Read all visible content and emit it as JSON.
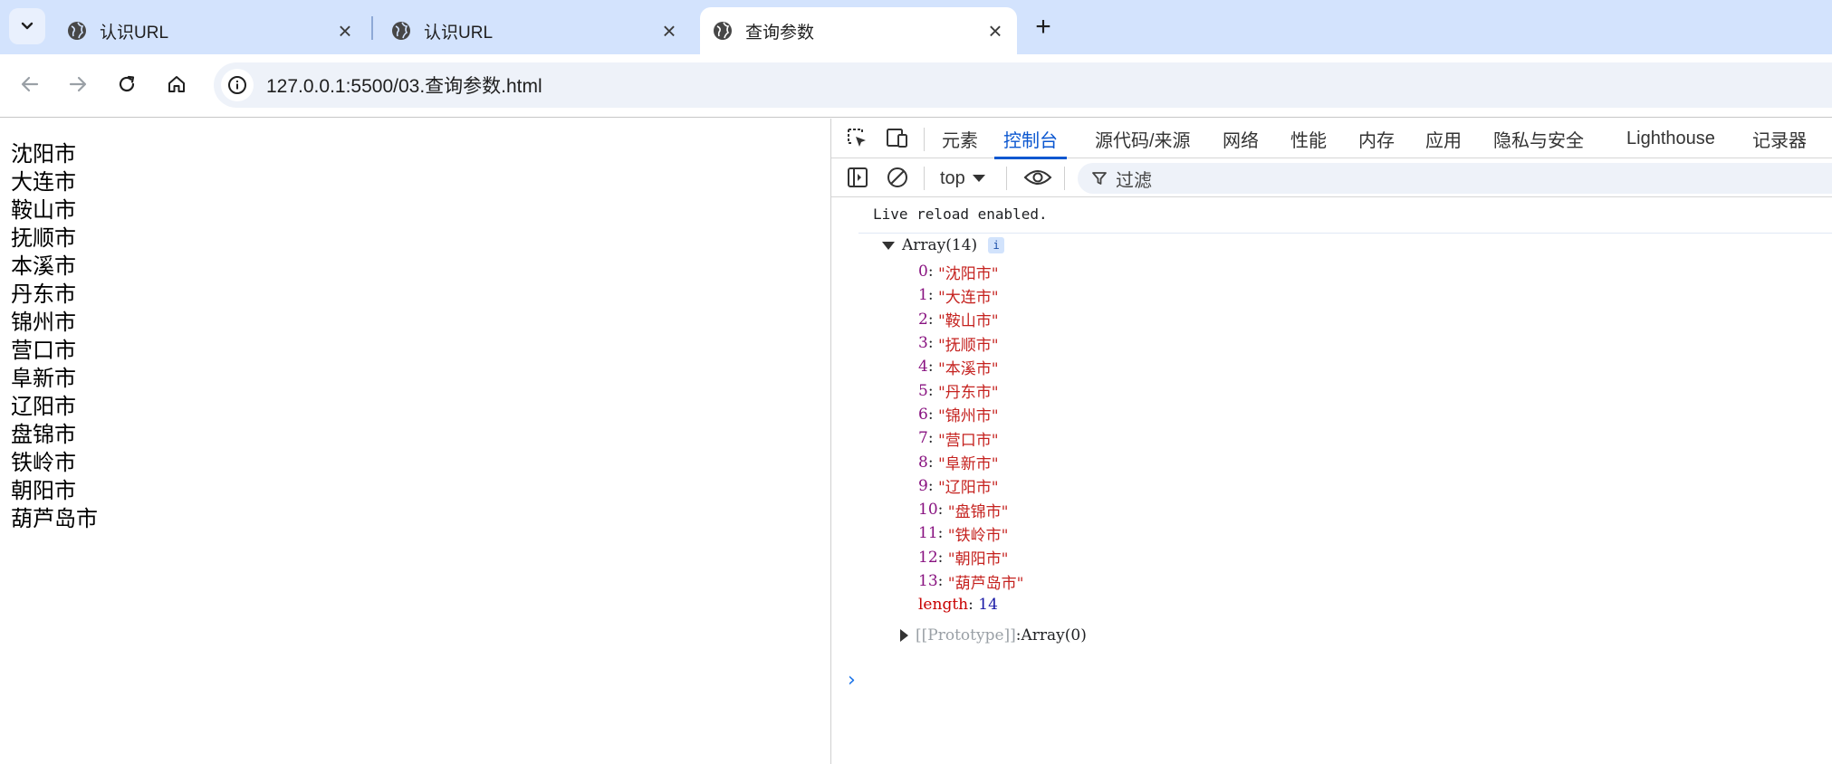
{
  "tabs": [
    {
      "title": "认识URL",
      "close": "×"
    },
    {
      "title": "认识URL",
      "close": "×"
    },
    {
      "title": "查询参数",
      "close": "×"
    }
  ],
  "new_tab_label": "+",
  "address": {
    "url": "127.0.0.1:5500/03.查询参数.html"
  },
  "page": {
    "cities": [
      "沈阳市",
      "大连市",
      "鞍山市",
      "抚顺市",
      "本溪市",
      "丹东市",
      "锦州市",
      "营口市",
      "阜新市",
      "辽阳市",
      "盘锦市",
      "铁岭市",
      "朝阳市",
      "葫芦岛市"
    ]
  },
  "devtools": {
    "tabs": [
      "元素",
      "控制台",
      "源代码/来源",
      "网络",
      "性能",
      "内存",
      "应用",
      "隐私与安全",
      "Lighthouse",
      "记录器"
    ],
    "active_tab": "控制台",
    "context": "top",
    "filter_label": "过滤",
    "console": {
      "live_reload": "Live reload enabled.",
      "array_header": "Array(14)",
      "info_badge": "i",
      "entries": [
        {
          "key": "0",
          "value": "\"沈阳市\""
        },
        {
          "key": "1",
          "value": "\"大连市\""
        },
        {
          "key": "2",
          "value": "\"鞍山市\""
        },
        {
          "key": "3",
          "value": "\"抚顺市\""
        },
        {
          "key": "4",
          "value": "\"本溪市\""
        },
        {
          "key": "5",
          "value": "\"丹东市\""
        },
        {
          "key": "6",
          "value": "\"锦州市\""
        },
        {
          "key": "7",
          "value": "\"营口市\""
        },
        {
          "key": "8",
          "value": "\"阜新市\""
        },
        {
          "key": "9",
          "value": "\"辽阳市\""
        },
        {
          "key": "10",
          "value": "\"盘锦市\""
        },
        {
          "key": "11",
          "value": "\"铁岭市\""
        },
        {
          "key": "12",
          "value": "\"朝阳市\""
        },
        {
          "key": "13",
          "value": "\"葫芦岛市\""
        }
      ],
      "length_key": "length",
      "length_value": "14",
      "prototype_key": "[[Prototype]]",
      "prototype_value": "Array(0)",
      "prompt": "›"
    }
  },
  "colors": {
    "tabstrip": "#d3e3fd",
    "accent": "#0b57d0",
    "key": "#881280",
    "string": "#c5221f",
    "number": "#1a1aa6"
  }
}
